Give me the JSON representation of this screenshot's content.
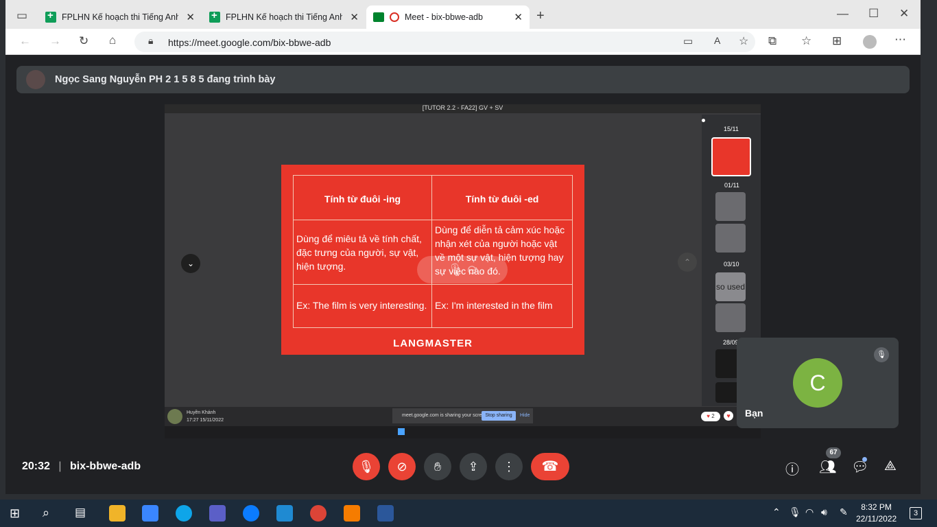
{
  "browser": {
    "tabs": [
      {
        "title": "FPLHN Kế hoạch thi Tiếng Anh-F",
        "active": false
      },
      {
        "title": "FPLHN Kế hoạch thi Tiếng Anh-F",
        "active": false
      },
      {
        "title": "Meet - bix-bbwe-adb",
        "active": true
      }
    ],
    "url": "https://meet.google.com/bix-bbwe-adb"
  },
  "meet": {
    "presenter_text": "Ngọc Sang Nguyễn PH 2 1 5 8 5 đang trình bày",
    "shared_window_title": "[TUTOR 2.2 - FA22] GV + SV",
    "slide": {
      "header_left": "Tính từ đuôi -ing",
      "header_right": "Tính từ đuôi -ed",
      "row1_left": "Dùng để miêu tả về tính chất, đặc trưng của người, sự vật, hiện tượng.",
      "row1_right": "Dùng để diễn tả cảm xúc hoặc nhận xét của người hoặc vật về một sự vật, hiện tượng hay sự việc nào đó.",
      "row2_left": "Ex: The film is very interesting.",
      "row2_right": "Ex: I'm interested in the film",
      "brand": "LANGMASTER"
    },
    "thumbnail_dates": [
      "15/11",
      "01/11",
      "03/10",
      "28/09"
    ],
    "thumbnail_text": "so used",
    "bottom_user_name": "Huyền Khánh",
    "bottom_user_time": "17:27 15/11/2022",
    "share_notice": "meet.google.com is sharing your screen.",
    "stop_sharing": "Stop sharing",
    "hide": "Hide",
    "reaction_count": "2",
    "self_initial": "C",
    "self_name": "Bạn",
    "time": "20:32",
    "meeting_code": "bix-bbwe-adb",
    "participants_count": "67"
  },
  "taskbar": {
    "clock_time": "8:32 PM",
    "clock_date": "22/11/2022",
    "notifications": "3"
  },
  "colors": {
    "slide_red": "#e8362a",
    "end_call": "#ea4335",
    "self_avatar": "#7cb342"
  }
}
